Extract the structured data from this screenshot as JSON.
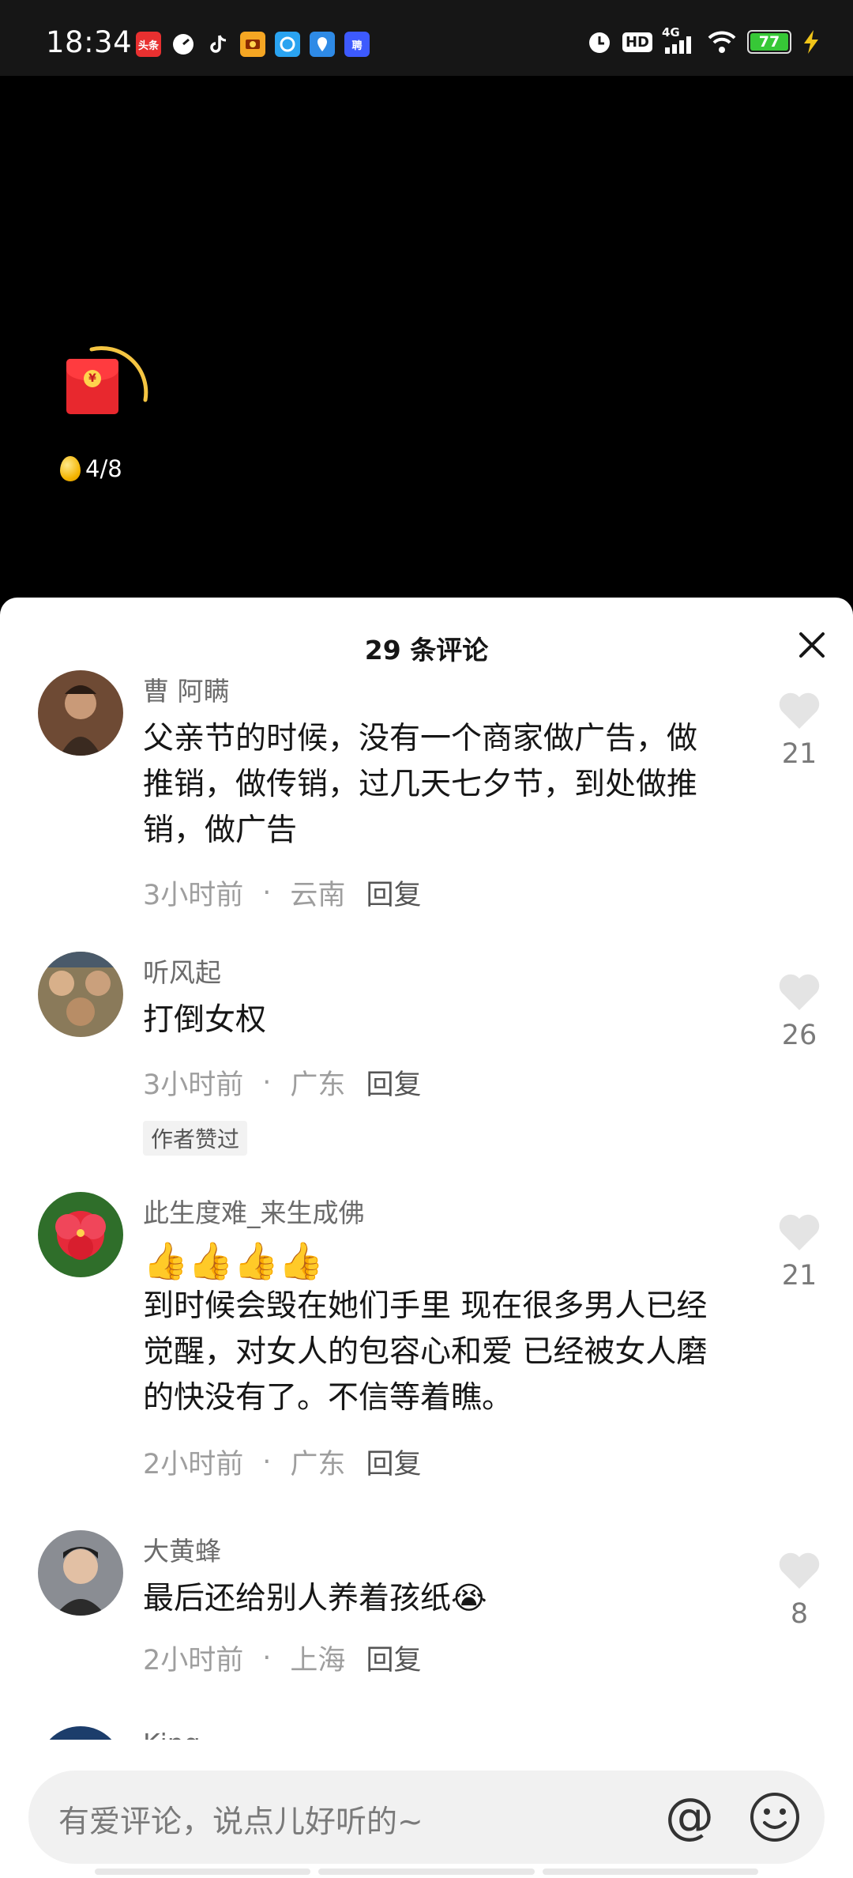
{
  "status_bar": {
    "time": "18:34",
    "notif_icons": [
      {
        "name": "toutiao-app-icon",
        "label": "头条",
        "color": "#e83030"
      },
      {
        "name": "speedometer-app-icon",
        "label": "",
        "color": "#ffffff"
      },
      {
        "name": "tiktok-app-icon",
        "label": "",
        "color": "#000000"
      },
      {
        "name": "orange-app-icon",
        "label": "",
        "color": "#f5a623"
      },
      {
        "name": "browser-app-icon",
        "label": "",
        "color": "#2aa3f0"
      },
      {
        "name": "map-app-icon",
        "label": "",
        "color": "#2e8ae6"
      },
      {
        "name": "recruit-app-icon",
        "label": "聘",
        "color": "#3d5afe"
      }
    ],
    "network": "4G",
    "hd": "HD",
    "battery": "77",
    "battery_level": 0.77
  },
  "video": {
    "coin_progress": "4/8"
  },
  "comments_sheet": {
    "title": "29 条评论",
    "comments": [
      {
        "user": "曹 阿瞒",
        "text": "父亲节的时候，没有一个商家做广告，做推销，做传销，过几天七夕节，到处做推销，做广告",
        "time": "3小时前",
        "location": "云南",
        "reply": "回复",
        "likes": "21"
      },
      {
        "user": "听风起",
        "text": "打倒女权",
        "time": "3小时前",
        "location": "广东",
        "reply": "回复",
        "badge": "作者赞过",
        "likes": "26"
      },
      {
        "user": "此生度难_来生成佛",
        "emoji": "👍👍👍👍",
        "text": "到时候会毁在她们手里 现在很多男人已经觉醒，对女人的包容心和爱 已经被女人磨的快没有了。不信等着瞧。",
        "time": "2小时前",
        "location": "广东",
        "reply": "回复",
        "likes": "21"
      },
      {
        "user": "大黄蜂",
        "text": "最后还给别人养着孩纸😭",
        "time": "2小时前",
        "location": "上海",
        "reply": "回复",
        "likes": "8"
      },
      {
        "user": "King"
      }
    ]
  },
  "input_bar": {
    "placeholder": "有爱评论，说点儿好听的~",
    "at_symbol": "@"
  }
}
